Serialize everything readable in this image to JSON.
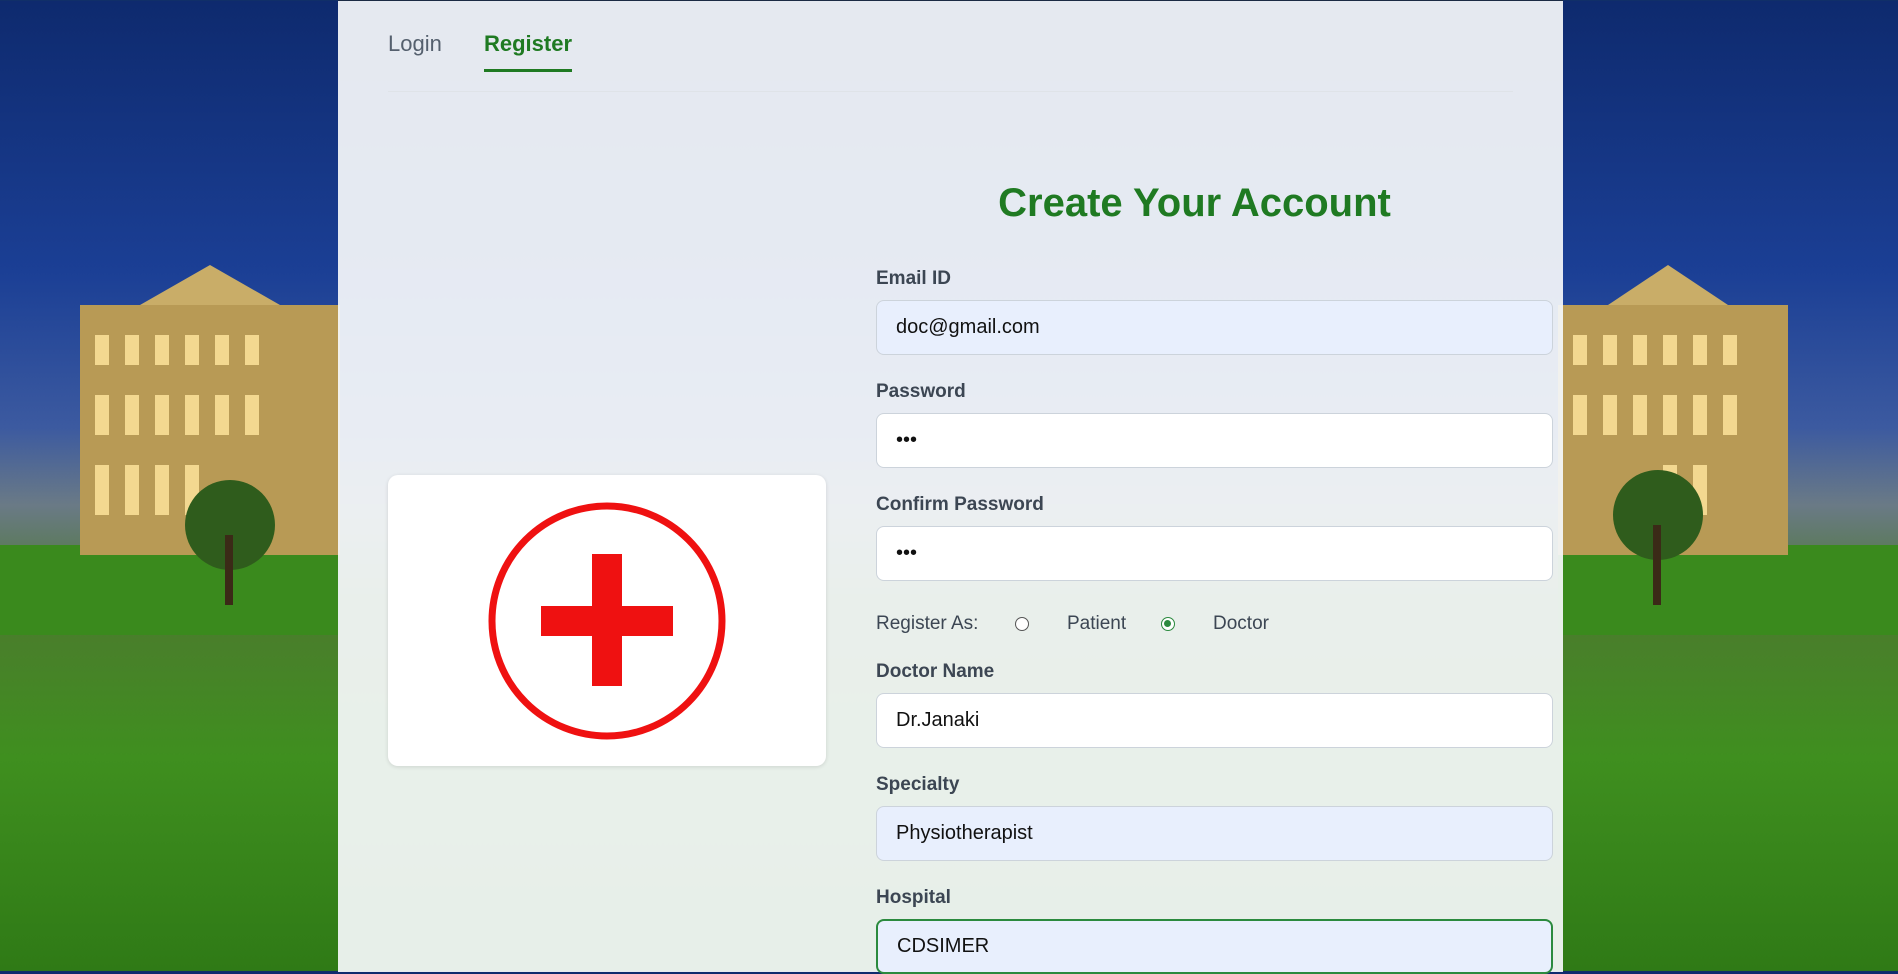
{
  "tabs": {
    "login": "Login",
    "register": "Register",
    "active": "Register"
  },
  "form": {
    "title": "Create Your Account",
    "email": {
      "label": "Email ID",
      "value": "doc@gmail.com"
    },
    "password": {
      "label": "Password",
      "value": "•••"
    },
    "confirm_password": {
      "label": "Confirm Password",
      "value": "•••"
    },
    "register_as": {
      "label": "Register As:",
      "options": [
        "Patient",
        "Doctor"
      ],
      "selected": "Doctor"
    },
    "doctor_name": {
      "label": "Doctor Name",
      "value": "Dr.Janaki"
    },
    "specialty": {
      "label": "Specialty",
      "value": "Physiotherapist"
    },
    "hospital": {
      "label": "Hospital",
      "value": "CDSIMER"
    }
  },
  "logo": {
    "icon": "red-cross-icon",
    "color": "#ef1111"
  },
  "colors": {
    "accent": "#1f7a22",
    "focus": "#2b8a3e"
  }
}
